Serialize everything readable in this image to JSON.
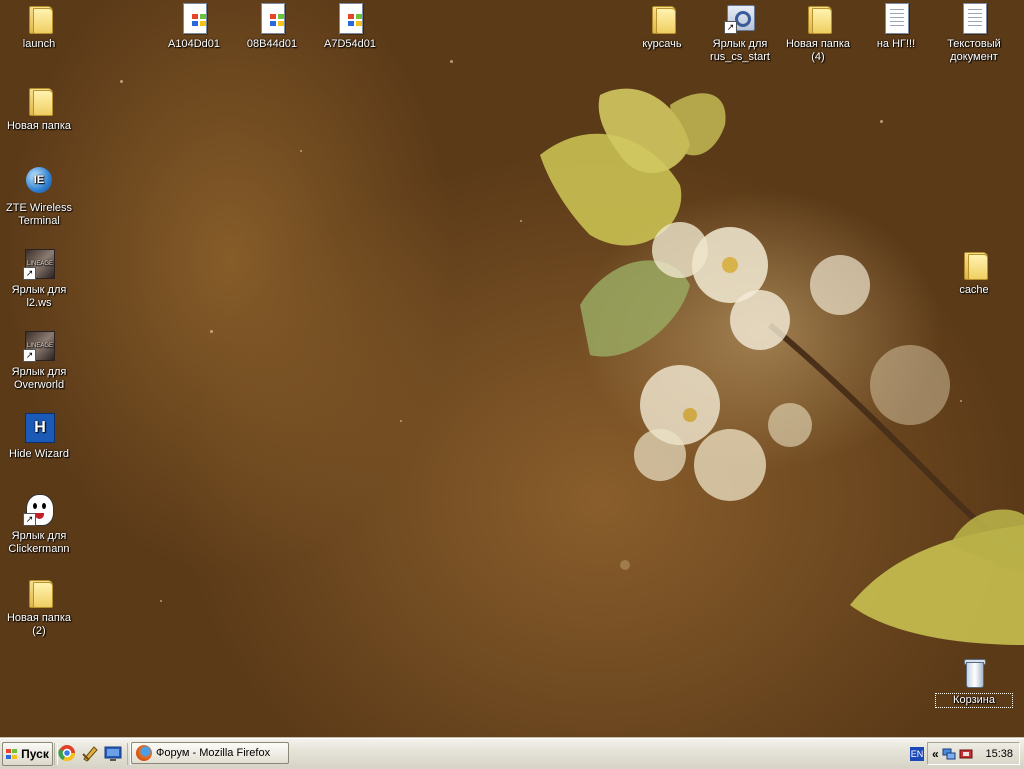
{
  "desktop": {
    "icons": [
      {
        "label": "launch",
        "type": "folder"
      },
      {
        "label": "Новая папка",
        "type": "folder"
      },
      {
        "label": "ZTE Wireless Terminal",
        "type": "app-zte"
      },
      {
        "label": "Ярлык для l2.ws",
        "type": "app-l2"
      },
      {
        "label": "Ярлык для Overworld",
        "type": "app-l2"
      },
      {
        "label": "Hide Wizard",
        "type": "app-hide"
      },
      {
        "label": "Ярлык для Clickermann",
        "type": "app-click"
      },
      {
        "label": "Новая папка (2)",
        "type": "folder"
      },
      {
        "label": "A104Dd01",
        "type": "doc-win"
      },
      {
        "label": "08B44d01",
        "type": "doc-win"
      },
      {
        "label": "A7D54d01",
        "type": "doc-win"
      },
      {
        "label": "курсачь",
        "type": "folder"
      },
      {
        "label": "Ярлык для rus_cs_start",
        "type": "app-rus"
      },
      {
        "label": "Новая папка (4)",
        "type": "folder"
      },
      {
        "label": "на НГ!!!",
        "type": "doc"
      },
      {
        "label": "Текстовый документ",
        "type": "doc"
      },
      {
        "label": "cache",
        "type": "folder"
      },
      {
        "label": "Корзина",
        "type": "trash"
      }
    ]
  },
  "taskbar": {
    "start_label": "Пуск",
    "quick_launch": [
      "chrome-icon",
      "tool-icon",
      "show-desktop-icon"
    ],
    "tasks": [
      {
        "label": "Форум - Mozilla Firefox",
        "icon": "firefox-icon"
      }
    ],
    "language": "EN",
    "tray_chevron": "«",
    "clock": "15:38"
  },
  "colors": {
    "taskbar_bg": "#e5e3d8",
    "wallpaper_base": "#5a3a19"
  }
}
